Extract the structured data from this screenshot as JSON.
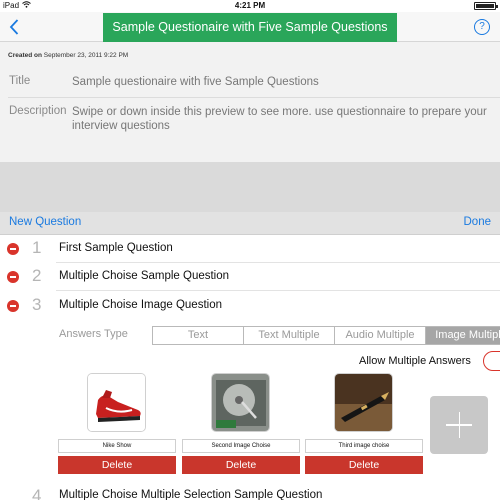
{
  "status_bar": {
    "device": "iPad",
    "time": "4:21 PM",
    "battery_level": 0.9
  },
  "nav": {
    "title": "Sample Questionaire with Five Sample Questions",
    "back_icon": "chevron-left-icon",
    "help_label": "?"
  },
  "meta": {
    "created_label": "Created on",
    "created_value": "September 23, 2011 9:22 PM",
    "title_label": "Title",
    "title_value": "Sample questionaire with five Sample Questions",
    "description_label": "Description",
    "description_value": "Swipe or down inside this preview  to see more. use questionnaire  to prepare your interview questions"
  },
  "toolbar": {
    "new_question": "New Question",
    "done": "Done"
  },
  "questions": [
    {
      "number": "1",
      "text": "First Sample Question"
    },
    {
      "number": "2",
      "text": "Multiple Choise Sample Question"
    },
    {
      "number": "3",
      "text": "Multiple Choise Image Question"
    },
    {
      "number": "4",
      "text": "Multiple Choise Multiple Selection Sample Question"
    }
  ],
  "answers": {
    "label": "Answers Type",
    "types": [
      "Text",
      "Text Multiple",
      "Audio Multiple",
      "Image Multiple"
    ],
    "selected_type": "Image Multiple",
    "allow_multiple_label": "Allow Multiple Answers",
    "allow_multiple_on": false,
    "images": [
      {
        "caption": "Nike Show",
        "delete_label": "Delete"
      },
      {
        "caption": "Second Image Choise",
        "delete_label": "Delete"
      },
      {
        "caption": "Third image choise",
        "delete_label": "Delete"
      }
    ]
  },
  "colors": {
    "accent": "#1a7ae0",
    "title_bg": "#2aa65a",
    "delete": "#c9362c"
  }
}
